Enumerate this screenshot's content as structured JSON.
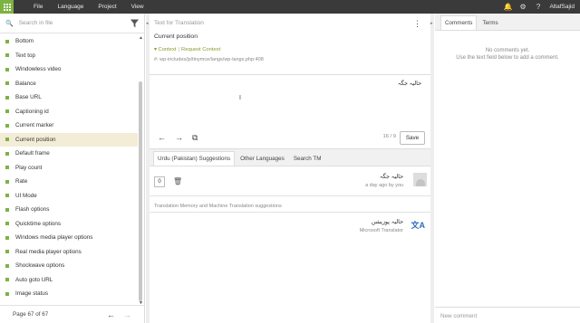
{
  "topbar": {
    "menu": [
      "File",
      "Language",
      "Project",
      "View"
    ],
    "user": "AltafSajid"
  },
  "search": {
    "placeholder": "Search in file"
  },
  "list": [
    "Bottom",
    "Text top",
    "Windowless video",
    "Balance",
    "Base URL",
    "Captioning id",
    "Current marker",
    "Current position",
    "Default frame",
    "Play count",
    "Rate",
    "UI Mode",
    "Flash options",
    "Quicktime options",
    "Windows media player options",
    "Real media player options",
    "Shockwave options",
    "Auto goto URL",
    "Image status"
  ],
  "selected_index": 7,
  "pager": {
    "label": "Page 67 of 67"
  },
  "source": {
    "label": "Text for Translation",
    "text": "Current position",
    "context": "Context",
    "request": "Request Context",
    "path": "#: wp-includes/js/tinymce/langs/wp-langs.php:408"
  },
  "editor": {
    "text": "حالیہ جگہ",
    "count": "16 / 9",
    "save": "Save"
  },
  "tabs": [
    "Urdu (Pakistan) Suggestions",
    "Other Languages",
    "Search TM"
  ],
  "suggestion": {
    "votes": "0",
    "text": "حالیہ جگہ",
    "meta": "a day ago by you"
  },
  "tm": {
    "label": "Translation Memory and Machine Translation suggestions",
    "text": "حالیہ پوزیشن",
    "source": "Microsoft Translator"
  },
  "comments": {
    "tabs": [
      "Comments",
      "Terms"
    ],
    "empty1": "No comments yet.",
    "empty2": "Use the text field below to add a comment.",
    "new": "New comment"
  }
}
